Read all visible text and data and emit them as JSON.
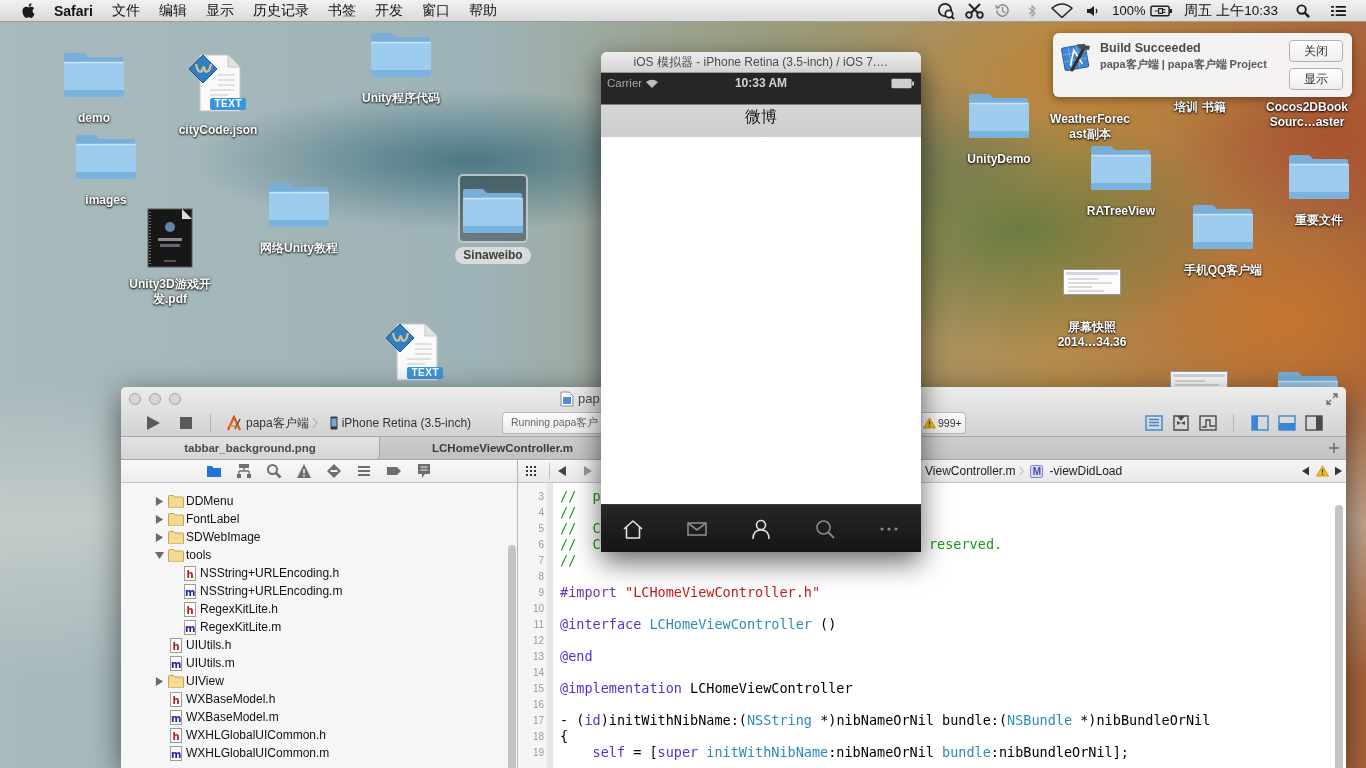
{
  "menu_bar": {
    "app": "Safari",
    "menus": [
      "文件",
      "编辑",
      "显示",
      "历史记录",
      "书签",
      "开发",
      "窗口",
      "帮助"
    ],
    "battery": "100%",
    "clock": "周五 上午10:33"
  },
  "desktop_icons": [
    {
      "lines": [
        "demo"
      ],
      "kind": "folder",
      "selected": false
    },
    {
      "lines": [
        "cityCode.json"
      ],
      "kind": "text-file",
      "badge": "TEXT",
      "selected": false
    },
    {
      "lines": [
        "Unity程序代码"
      ],
      "kind": "folder",
      "selected": false
    },
    {
      "lines": [
        "images"
      ],
      "kind": "folder",
      "selected": false
    },
    {
      "lines": [
        "网络Unity教程"
      ],
      "kind": "folder",
      "selected": false
    },
    {
      "lines": [
        "Sinaweibo"
      ],
      "kind": "folder",
      "selected": true
    },
    {
      "lines": [
        "Unity3D游戏开",
        "发.pdf"
      ],
      "kind": "pdf",
      "selected": false
    },
    {
      "kind": "text-file",
      "badge": "TEXT",
      "selected": false
    },
    {
      "lines": [
        "WeatherForec",
        "ast副本"
      ],
      "selected": false
    },
    {
      "lines": [
        "培训 书籍"
      ],
      "selected": false
    },
    {
      "lines": [
        "Cocos2DBook",
        "Sourc…aster"
      ],
      "selected": false
    },
    {
      "lines": [
        "UnityDemo"
      ],
      "kind": "folder",
      "selected": false
    },
    {
      "lines": [
        "RATreeView"
      ],
      "kind": "folder",
      "selected": false
    },
    {
      "lines": [
        "重要文件"
      ],
      "kind": "folder",
      "selected": false
    },
    {
      "lines": [
        "手机QQ客户端"
      ],
      "kind": "folder",
      "selected": false
    },
    {
      "lines": [
        "屏幕快照",
        "2014…34.36"
      ],
      "kind": "screenshot",
      "selected": false
    },
    {
      "kind": "screenshot",
      "selected": false
    },
    {
      "kind": "folder",
      "selected": false
    }
  ],
  "notification": {
    "title": "Build Succeeded",
    "subtitle": "papa客户端 | papa客户端 Project",
    "buttons": [
      "关闭",
      "显示"
    ]
  },
  "simulator": {
    "title": "iOS 模拟器 - iPhone Retina (3.5-inch) / iOS 7.…",
    "carrier": "Carrier",
    "time": "10:33 AM",
    "nav_title": "微博",
    "tabs": [
      {
        "kind": "home",
        "selected": true
      },
      {
        "kind": "mail",
        "selected": false
      },
      {
        "kind": "profile",
        "selected": true
      },
      {
        "kind": "search",
        "selected": false
      },
      {
        "kind": "more",
        "selected": false
      }
    ]
  },
  "xcode": {
    "title": "pap",
    "scheme": "papa客户端",
    "device": "iPhone Retina (3.5-inch)",
    "activity": "Running papa客户",
    "issues": "999+",
    "editor_modes": [
      {
        "kind": "standard",
        "selected": true
      },
      {
        "kind": "assistant",
        "selected": false
      },
      {
        "kind": "version",
        "selected": false
      }
    ],
    "panels": [
      {
        "kind": "navigator",
        "on": true
      },
      {
        "kind": "debug",
        "on": true
      },
      {
        "kind": "utilities",
        "on": false
      }
    ],
    "tabs": [
      {
        "label": "tabbar_background.png",
        "selected": false
      },
      {
        "label": "LCHomeViewController.m",
        "selected": true
      }
    ],
    "navigators": [
      {
        "kind": "project",
        "selected": true
      },
      {
        "kind": "symbol",
        "selected": false
      },
      {
        "kind": "find",
        "selected": false
      },
      {
        "kind": "issue",
        "selected": false
      },
      {
        "kind": "test",
        "selected": false
      },
      {
        "kind": "debug",
        "selected": false
      },
      {
        "kind": "breakpoint",
        "selected": false
      },
      {
        "kind": "log",
        "selected": false
      }
    ],
    "tree": [
      {
        "name": "DDMenu",
        "kind": "folder",
        "expanded": false
      },
      {
        "name": "FontLabel",
        "kind": "folder",
        "expanded": false
      },
      {
        "name": "SDWebImage",
        "kind": "folder",
        "expanded": false
      },
      {
        "name": "tools",
        "kind": "folder",
        "expanded": true,
        "children": [
          {
            "name": "NSString+URLEncoding.h",
            "kind": "header",
            "letter": "h"
          },
          {
            "name": "NSString+URLEncoding.m",
            "kind": "source",
            "letter": "m"
          },
          {
            "name": "RegexKitLite.h",
            "kind": "header",
            "letter": "h"
          },
          {
            "name": "RegexKitLite.m",
            "kind": "source",
            "letter": "m"
          }
        ]
      },
      {
        "name": "UIUtils.h",
        "kind": "header",
        "letter": "h"
      },
      {
        "name": "UIUtils.m",
        "kind": "source",
        "letter": "m"
      },
      {
        "name": "UIView",
        "kind": "folder",
        "expanded": false
      },
      {
        "name": "WXBaseModel.h",
        "kind": "header",
        "letter": "h"
      },
      {
        "name": "WXBaseModel.m",
        "kind": "source",
        "letter": "m"
      },
      {
        "name": "WXHLGlobalUICommon.h",
        "kind": "header",
        "letter": "h"
      },
      {
        "name": "WXHLGlobalUICommon.m",
        "kind": "source",
        "letter": "m"
      }
    ],
    "jump_bar": {
      "file": "ViewController.m",
      "badge": "M",
      "method": "-viewDidLoad"
    },
    "code": [
      {
        "number": "3",
        "tokens": [
          {
            "kind": "comment",
            "text": "//  p"
          }
        ]
      },
      {
        "number": "4",
        "tokens": [
          {
            "kind": "comment",
            "text": "//"
          }
        ]
      },
      {
        "number": "5",
        "tokens": [
          {
            "kind": "comment",
            "text": "//  C"
          }
        ]
      },
      {
        "number": "6",
        "tokens": [
          {
            "kind": "comment",
            "text": "//  C"
          }
        ],
        "tail": [
          {
            "kind": "comment",
            "text": "reserved."
          }
        ]
      },
      {
        "number": "7",
        "tokens": [
          {
            "kind": "comment",
            "text": "//"
          }
        ]
      },
      {
        "number": "8"
      },
      {
        "number": "9",
        "tokens": [
          {
            "kind": "preprocessor",
            "text": "#import "
          },
          {
            "kind": "string",
            "text": "\"LCHomeViewController.h\""
          }
        ]
      },
      {
        "number": "10"
      },
      {
        "number": "11",
        "tokens": [
          {
            "kind": "keyword",
            "text": "@interface"
          },
          {
            "kind": "class",
            "text": " LCHomeViewController"
          },
          {
            "kind": "plain",
            "text": " ()"
          }
        ]
      },
      {
        "number": "12"
      },
      {
        "number": "13",
        "tokens": [
          {
            "kind": "keyword",
            "text": "@end"
          }
        ]
      },
      {
        "number": "14"
      },
      {
        "number": "15",
        "tokens": [
          {
            "kind": "keyword",
            "text": "@implementation"
          },
          {
            "kind": "plain",
            "text": " LCHomeViewController"
          }
        ]
      },
      {
        "number": "16"
      },
      {
        "number": "17",
        "tokens": [
          {
            "kind": "plain",
            "text": "- ("
          },
          {
            "kind": "keyword",
            "text": "id"
          },
          {
            "kind": "plain",
            "text": ")initWithNibName:("
          },
          {
            "kind": "class",
            "text": "NSString"
          },
          {
            "kind": "plain",
            "text": " *)nibNameOrNil bundle:("
          },
          {
            "kind": "class",
            "text": "NSBundle"
          },
          {
            "kind": "plain",
            "text": " *)nibBundleOrNil"
          }
        ]
      },
      {
        "number": "18",
        "tokens": [
          {
            "kind": "plain",
            "text": "{"
          }
        ]
      },
      {
        "number": "19",
        "tokens": [
          {
            "kind": "keyword",
            "text": "    self"
          },
          {
            "kind": "plain",
            "text": " = ["
          },
          {
            "kind": "keyword",
            "text": "super"
          },
          {
            "kind": "class",
            "text": " initWithNibName"
          },
          {
            "kind": "plain",
            "text": ":nibNameOrNil "
          },
          {
            "kind": "class",
            "text": "bundle"
          },
          {
            "kind": "plain",
            "text": ":nibBundleOrNil];"
          }
        ]
      }
    ]
  }
}
